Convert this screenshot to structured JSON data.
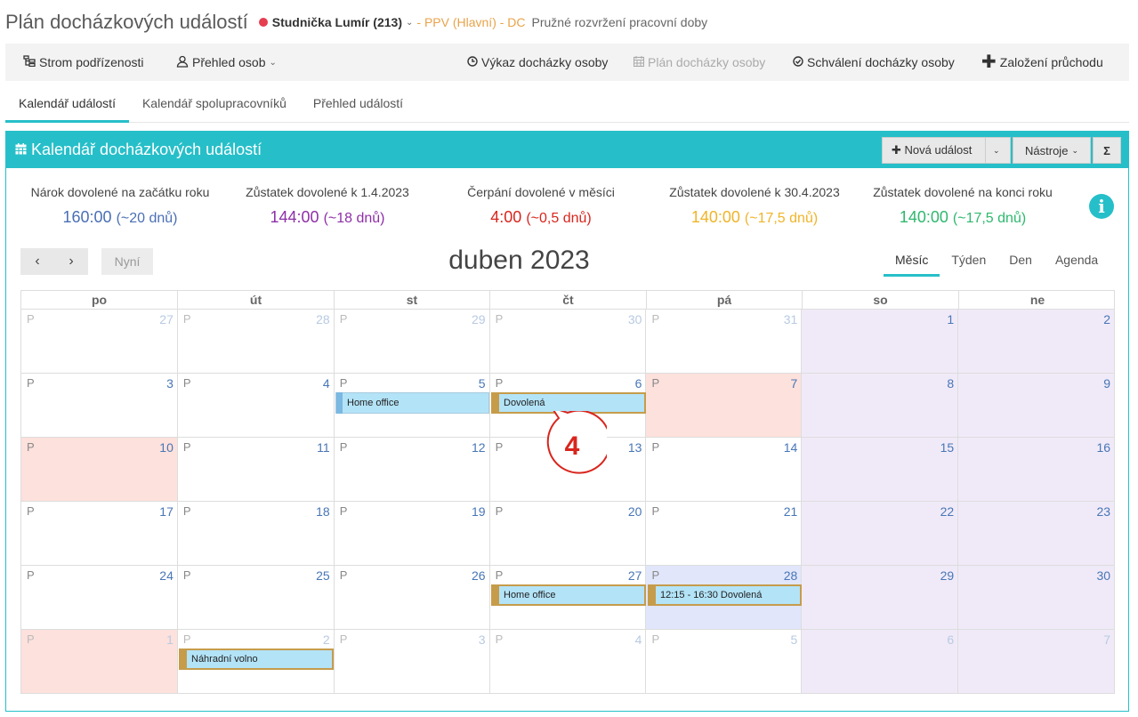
{
  "header": {
    "title": "Plán docházkových událostí",
    "user_name": "Studnička Lumír (213)",
    "org": "- PPV (Hlavní) - DC",
    "schedule": "Pružné rozvržení pracovní doby"
  },
  "toolbar": {
    "tree_label": "Strom podřízenosti",
    "people_label": "Přehled osob",
    "attendance_report_label": "Výkaz docházky osoby",
    "attendance_plan_label": "Plán docházky osoby",
    "approval_label": "Schválení docházky osoby",
    "create_pass_label": "Založení průchodu"
  },
  "tabs": [
    {
      "label": "Kalendář událostí",
      "active": true
    },
    {
      "label": "Kalendář spolupracovníků",
      "active": false
    },
    {
      "label": "Přehled událostí",
      "active": false
    }
  ],
  "panel": {
    "title": "Kalendář docházkových událostí",
    "new_event_label": "Nová událost",
    "tools_label": "Nástroje",
    "sigma_label": "Σ"
  },
  "stats": [
    {
      "label": "Nárok dovolené na začátku roku",
      "value": "160:00",
      "sub": "(~20 dnů)",
      "color": "#4a6fb5"
    },
    {
      "label": "Zůstatek dovolené k 1.4.2023",
      "value": "144:00",
      "sub": "(~18 dnů)",
      "color": "#8e2fa8"
    },
    {
      "label": "Čerpání dovolené v měsíci",
      "value": "4:00",
      "sub": "(~0,5 dnů)",
      "color": "#d9251d"
    },
    {
      "label": "Zůstatek dovolené k 30.4.2023",
      "value": "140:00",
      "sub": "(~17,5 dnů)",
      "color": "#f0b429"
    },
    {
      "label": "Zůstatek dovolené na konci roku",
      "value": "140:00",
      "sub": "(~17,5 dnů)",
      "color": "#2eb86e"
    }
  ],
  "calendar": {
    "today_label": "Nyní",
    "month_title": "duben 2023",
    "views": [
      "Měsíc",
      "Týden",
      "Den",
      "Agenda"
    ],
    "active_view": "Měsíc",
    "weekdays": [
      "po",
      "út",
      "st",
      "čt",
      "pá",
      "so",
      "ne"
    ],
    "day_marker": "P",
    "weeks": [
      [
        {
          "n": "27",
          "o": true
        },
        {
          "n": "28",
          "o": true
        },
        {
          "n": "29",
          "o": true
        },
        {
          "n": "30",
          "o": true
        },
        {
          "n": "31",
          "o": true
        },
        {
          "n": "1"
        },
        {
          "n": "2"
        }
      ],
      [
        {
          "n": "3"
        },
        {
          "n": "4"
        },
        {
          "n": "5"
        },
        {
          "n": "6"
        },
        {
          "n": "7",
          "hol": true
        },
        {
          "n": "8"
        },
        {
          "n": "9"
        }
      ],
      [
        {
          "n": "10",
          "hol": true
        },
        {
          "n": "11"
        },
        {
          "n": "12"
        },
        {
          "n": "13"
        },
        {
          "n": "14"
        },
        {
          "n": "15"
        },
        {
          "n": "16"
        }
      ],
      [
        {
          "n": "17"
        },
        {
          "n": "18"
        },
        {
          "n": "19"
        },
        {
          "n": "20"
        },
        {
          "n": "21"
        },
        {
          "n": "22"
        },
        {
          "n": "23"
        }
      ],
      [
        {
          "n": "24"
        },
        {
          "n": "25"
        },
        {
          "n": "26"
        },
        {
          "n": "27"
        },
        {
          "n": "28",
          "today": true
        },
        {
          "n": "29"
        },
        {
          "n": "30"
        }
      ],
      [
        {
          "n": "1",
          "o": true,
          "hol": true
        },
        {
          "n": "2",
          "o": true
        },
        {
          "n": "3",
          "o": true
        },
        {
          "n": "4",
          "o": true
        },
        {
          "n": "5",
          "o": true
        },
        {
          "n": "6",
          "o": true
        },
        {
          "n": "7",
          "o": true
        }
      ]
    ],
    "events": [
      {
        "week": 1,
        "day": 2,
        "label": "Home office",
        "style": "ho"
      },
      {
        "week": 1,
        "day": 3,
        "label": "Dovolená",
        "style": "gold"
      },
      {
        "week": 4,
        "day": 3,
        "label": "Home office",
        "style": "gold"
      },
      {
        "week": 4,
        "day": 4,
        "label": "12:15 - 16:30 Dovolená",
        "style": "gold"
      },
      {
        "week": 5,
        "day": 1,
        "label": "Náhradní volno",
        "style": "gold"
      }
    ]
  },
  "annotation": {
    "number": "4",
    "color": "#d9251d"
  }
}
